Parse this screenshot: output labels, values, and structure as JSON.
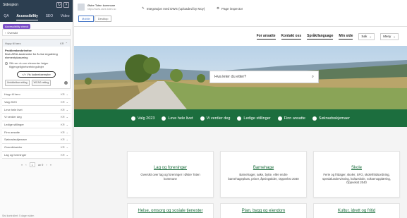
{
  "panel": {
    "title": "Sidespion",
    "icons": [
      "refresh-icon",
      "close-icon"
    ],
    "tabs": [
      "QA",
      "Accessibility",
      "SEO",
      "Video"
    ],
    "active_tab": "Accessibility",
    "pill": "Accessibility check",
    "crumb": "Oversikt",
    "section_head": "Hopp til hero",
    "section_body_title": "Problembeskrivelse",
    "section_body_text": "Bruk ARIA-landmerke for å vise regulering elementplassering",
    "radio_text": "Slik ser du om elementer følger tilgjengelighetsretningslinjer",
    "hide_button": "Vis kodeeksempler",
    "chip_1": "Umiddelbar retting",
    "chip_2": "WCAG retting",
    "items": [
      "Hopp til hero",
      "Valg 2023",
      "Leve hele livet",
      "Vi verdier deg",
      "Ledige stillinger",
      "Finn ansatte",
      "Søknadsskjemaer",
      "Oversiktssider",
      "Lag og foreninger"
    ],
    "item_badge": "KR",
    "pager_current": "1",
    "pager_of": "av 9",
    "status": "Sist kontrollert: 5 dager siden"
  },
  "topbar": {
    "site_name": "Østre Toten kommune",
    "site_url": "https://www.ostre-toten.no",
    "integration": "Integrasjon med DWS (uploaded by Moy)",
    "inspector": "Page inspector",
    "toggles": [
      "Mobile",
      "Desktop"
    ]
  },
  "site": {
    "nav": [
      "For ansatte",
      "Kontakt oss",
      "Språk/language",
      "Min side"
    ],
    "search_select": "Søk",
    "menu_select": "Meny",
    "search_placeholder": "Hva leter du etter?",
    "quick_links": [
      "Valg 2023",
      "Leve hele livet",
      "Vi verdier deg",
      "Ledige stillinger",
      "Finn ansatte",
      "Søknadsskjemaer"
    ],
    "cards": [
      {
        "title": "Lag og foreninger",
        "desc": "Oversikt over lag og foreninger i Østre Toten kommune"
      },
      {
        "title": "Barnehage",
        "desc": "Barnehager, søke, bytte, eller endre barnehageplass, priser, åpningstider, Oppvekst 2040"
      },
      {
        "title": "Skole",
        "desc": "Ferie og fridager, skoler, SFO, skolefritidsordning, spesialundervisning, kulturskole, voksenopplæring, Oppvekst 2040"
      }
    ],
    "cards_row2": [
      "Helse, omsorg og sosiale tjenester",
      "Plan, bygg og eiendom",
      "Kultur, idrett og fritid"
    ]
  },
  "colors": {
    "brand_green": "#1c6e3e",
    "panel_header": "#2c3e50",
    "pill_purple": "#7b4fc7"
  }
}
